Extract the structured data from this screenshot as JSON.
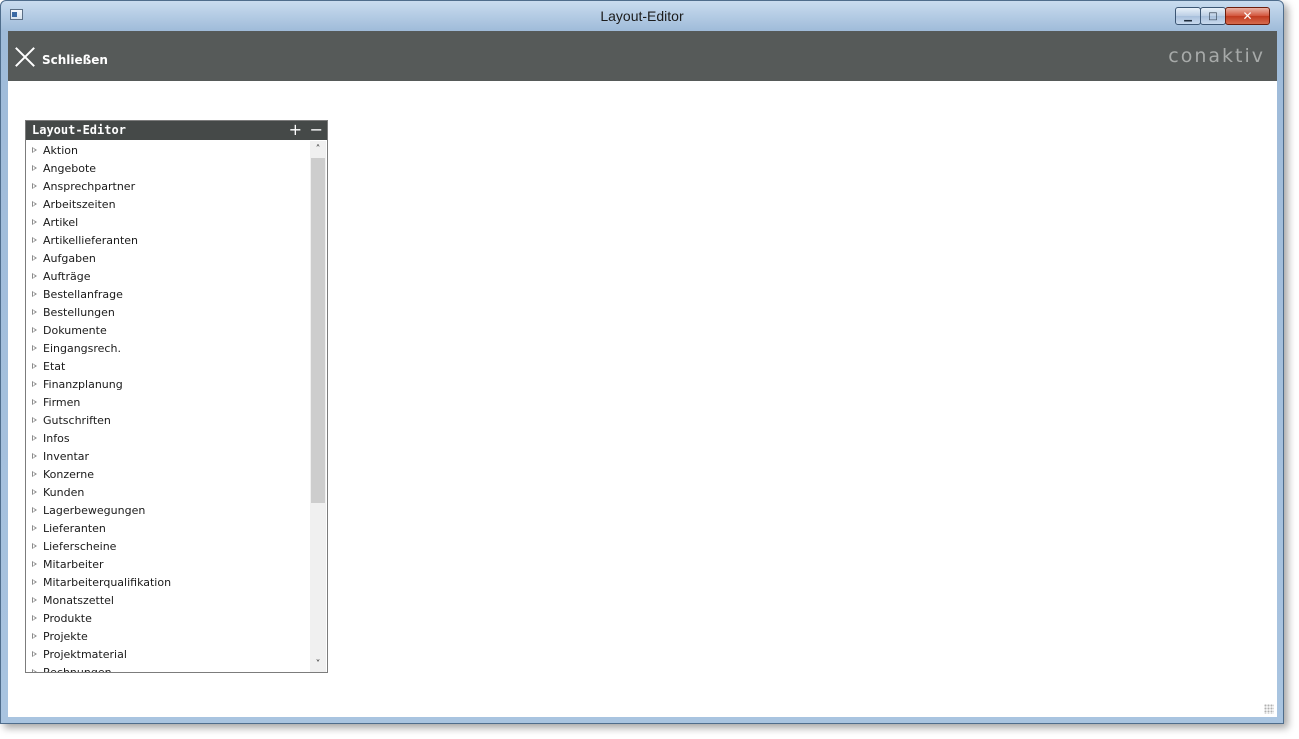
{
  "window": {
    "title": "Layout-Editor"
  },
  "toolbar": {
    "close_label": "Schließen",
    "logo_text": "conaktiv"
  },
  "panel": {
    "title": "Layout-Editor",
    "expand_symbol": "+",
    "collapse_symbol": "−",
    "items": [
      "Aktion",
      "Angebote",
      "Ansprechpartner",
      "Arbeitszeiten",
      "Artikel",
      "Artikellieferanten",
      "Aufgaben",
      "Aufträge",
      "Bestellanfrage",
      "Bestellungen",
      "Dokumente",
      "Eingangsrech.",
      "Etat",
      "Finanzplanung",
      "Firmen",
      "Gutschriften",
      "Infos",
      "Inventar",
      "Konzerne",
      "Kunden",
      "Lagerbewegungen",
      "Lieferanten",
      "Lieferscheine",
      "Mitarbeiter",
      "Mitarbeiterqualifikation",
      "Monatszettel",
      "Produkte",
      "Projekte",
      "Projektmaterial",
      "Rechnungen"
    ]
  },
  "icons": {
    "window_minimize": "minimize-icon",
    "window_maximize": "maximize-icon",
    "window_close": "close-icon",
    "toolbar_close": "close-x-icon",
    "tree_expand": "triangle-right-icon",
    "scroll_up": "chevron-up-icon",
    "scroll_down": "chevron-down-icon"
  },
  "colors": {
    "toolbar_bg": "#565a59",
    "panel_header_bg": "#454948",
    "window_frame": "#a9c4e0"
  }
}
